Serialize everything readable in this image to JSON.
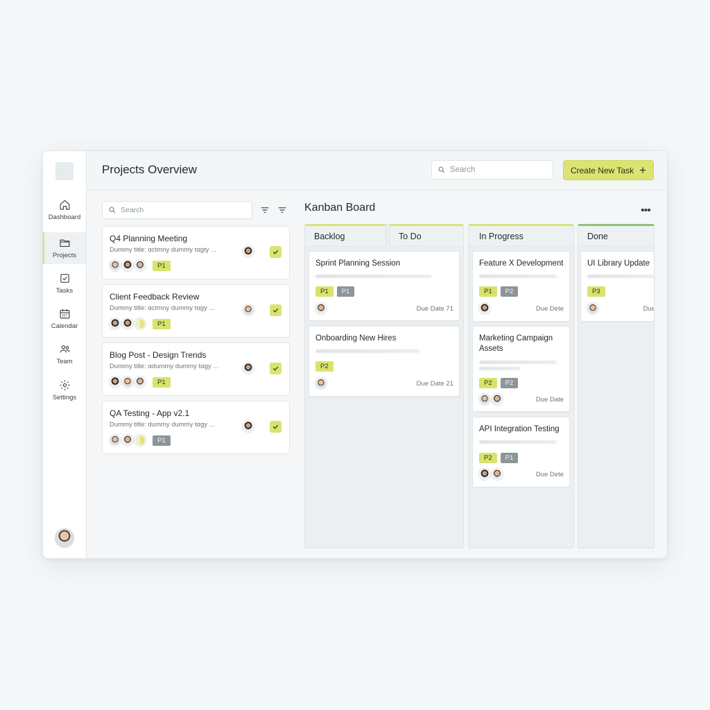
{
  "sidebar": {
    "items": [
      {
        "label": "Dashboard",
        "icon": "home-icon"
      },
      {
        "label": "Projects",
        "icon": "folder-icon",
        "active": true
      },
      {
        "label": "Tasks",
        "icon": "checkbox-icon"
      },
      {
        "label": "Calendar",
        "icon": "calendar-icon"
      },
      {
        "label": "Team",
        "icon": "team-icon"
      },
      {
        "label": "Settings",
        "icon": "gear-icon"
      }
    ]
  },
  "header": {
    "title": "Projects Overview",
    "search_placeholder": "Search",
    "create_label": "Create New Task",
    "create_icon": "+"
  },
  "list": {
    "search_placeholder": "Search",
    "projects": [
      {
        "title": "Q4 Planning Meeting",
        "subtitle": "Dummy title: αctmny dummy tαgty ...",
        "tag": "P1"
      },
      {
        "title": "Client Feedback Review",
        "subtitle": "Dummy title: αctmny dummy tαgy ...",
        "tag": "P1"
      },
      {
        "title": "Blog Post - Design Trends",
        "subtitle": "Dummy title: αdummy dummy tαgy ...",
        "tag": "P1"
      },
      {
        "title": "QA Testing - App v2.1",
        "subtitle": "Dummy title: dummy dummy tαgy ...",
        "tag": "P1"
      }
    ]
  },
  "kanban": {
    "title": "Kanban Board",
    "more_label": "•••",
    "columns": [
      {
        "name": "Backlog"
      },
      {
        "name": "To Do"
      },
      {
        "name": "In Progress"
      },
      {
        "name": "Done"
      }
    ],
    "cards": {
      "sprint": {
        "title": "Sprint Planning Session",
        "tags": [
          "P1",
          "P1"
        ],
        "due": "Due Date 71"
      },
      "onboarding": {
        "title": "Onboarding New Hires",
        "tags": [
          "P2"
        ],
        "due": "Due Date 21"
      },
      "feature": {
        "title": "Feature X Development",
        "tags": [
          "P1",
          "P2"
        ],
        "due": "Due Dete"
      },
      "marketing": {
        "title": "Marketing Campaign Assets",
        "tags": [
          "P2",
          "P2"
        ],
        "due": "Due Date"
      },
      "api": {
        "title": "API Integration Testing",
        "tags": [
          "P2",
          "P1"
        ],
        "due": "Due Dete"
      },
      "ui": {
        "title": "UI Library Update",
        "tags": [
          "P3"
        ],
        "due": "Due"
      }
    }
  },
  "colors": {
    "accent": "#dbe472",
    "accent_border": "#cbd55e",
    "done_accent": "#8fc27a",
    "tag_gray": "#8d9599"
  }
}
